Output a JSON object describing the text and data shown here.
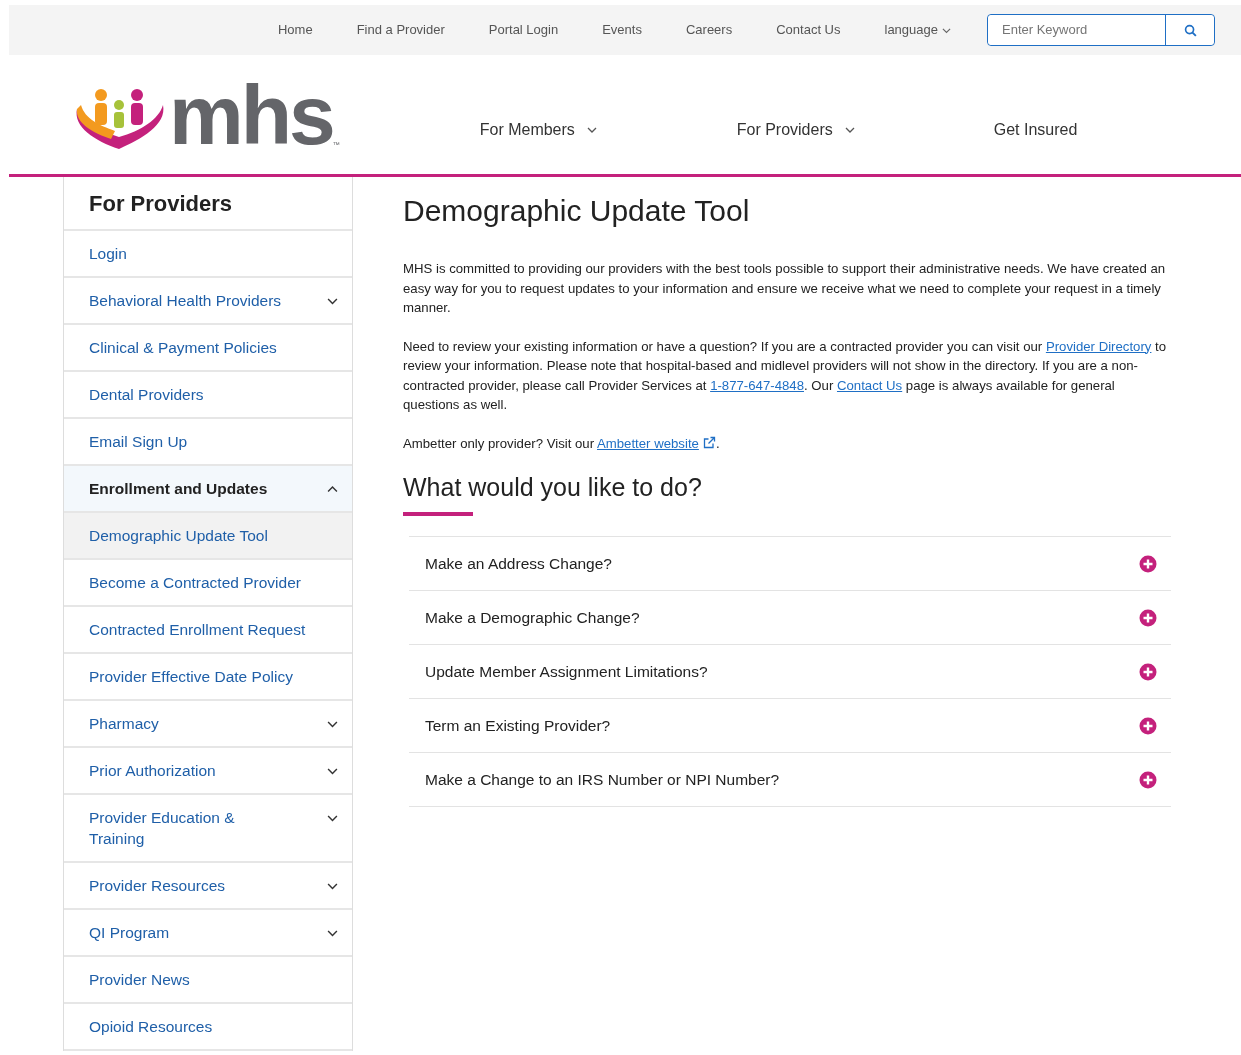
{
  "top_nav": {
    "links": [
      "Home",
      "Find a Provider",
      "Portal Login",
      "Events",
      "Careers",
      "Contact Us"
    ],
    "language": "language",
    "search": {
      "placeholder": "Enter Keyword"
    }
  },
  "logo": {
    "text": "mhs",
    "mark": "™"
  },
  "main_nav": [
    {
      "label": "For Members",
      "dropdown": true
    },
    {
      "label": "For Providers",
      "dropdown": true
    },
    {
      "label": "Get Insured",
      "dropdown": false
    }
  ],
  "sidebar": {
    "title": "For Providers",
    "items": [
      {
        "label": "Login",
        "kind": "link",
        "selected": false
      },
      {
        "label": "Behavioral Health Providers",
        "kind": "group",
        "expanded": false,
        "selected": false
      },
      {
        "label": "Clinical & Payment Policies",
        "kind": "link",
        "selected": false
      },
      {
        "label": "Dental Providers",
        "kind": "link",
        "selected": false
      },
      {
        "label": "Email Sign Up",
        "kind": "link",
        "selected": false
      },
      {
        "label": "Enrollment and Updates",
        "kind": "group",
        "expanded": true,
        "selected": false,
        "children": [
          {
            "label": "Demographic Update Tool",
            "kind": "link",
            "selected": true
          },
          {
            "label": "Become a Contracted Provider",
            "kind": "link",
            "selected": false
          },
          {
            "label": "Contracted Enrollment Request",
            "kind": "link",
            "selected": false
          },
          {
            "label": "Provider Effective Date Policy",
            "kind": "link",
            "selected": false
          }
        ]
      },
      {
        "label": "Pharmacy",
        "kind": "group",
        "expanded": false,
        "selected": false
      },
      {
        "label": "Prior Authorization",
        "kind": "group",
        "expanded": false,
        "selected": false
      },
      {
        "label": "Provider Education & Training",
        "kind": "group",
        "expanded": false,
        "selected": false
      },
      {
        "label": "Provider Resources",
        "kind": "group",
        "expanded": false,
        "selected": false
      },
      {
        "label": "QI Program",
        "kind": "group",
        "expanded": false,
        "selected": false
      },
      {
        "label": "Provider News",
        "kind": "link",
        "selected": false
      },
      {
        "label": "Opioid Resources",
        "kind": "link",
        "selected": false
      }
    ]
  },
  "content": {
    "title": "Demographic Update Tool",
    "paragraphs": [
      [
        {
          "kind": "text",
          "text": "MHS is committed to providing our providers with the best tools possible to support their administrative needs. We have created an easy way for you to request updates to your information and ensure we receive what we need to complete your request in a timely manner."
        }
      ],
      [
        {
          "kind": "text",
          "text": "Need to review your existing information or have a question? If you are a contracted provider you can visit our "
        },
        {
          "kind": "link",
          "text": "Provider Directory"
        },
        {
          "kind": "text",
          "text": " to review your information. Please note that hospital-based and midlevel providers will not show in the directory. If you are a non-contracted provider, please call Provider Services at "
        },
        {
          "kind": "link",
          "text": "1-877-647-4848"
        },
        {
          "kind": "text",
          "text": ". Our "
        },
        {
          "kind": "link",
          "text": "Contact Us"
        },
        {
          "kind": "text",
          "text": " page is always available for general questions as well."
        }
      ],
      [
        {
          "kind": "text",
          "text": "Ambetter only provider? Visit our "
        },
        {
          "kind": "external_link",
          "text": "Ambetter website"
        },
        {
          "kind": "text",
          "text": "."
        }
      ]
    ],
    "subtitle": "What would you like to do?",
    "accordion": [
      {
        "label": "Make an Address Change?",
        "expanded": false
      },
      {
        "label": "Make a Demographic Change?",
        "expanded": false
      },
      {
        "label": "Update Member Assignment Limitations?",
        "expanded": false
      },
      {
        "label": "Term an Existing Provider?",
        "expanded": false
      },
      {
        "label": "Make a Change to an IRS Number or NPI Number?",
        "expanded": false
      }
    ]
  }
}
